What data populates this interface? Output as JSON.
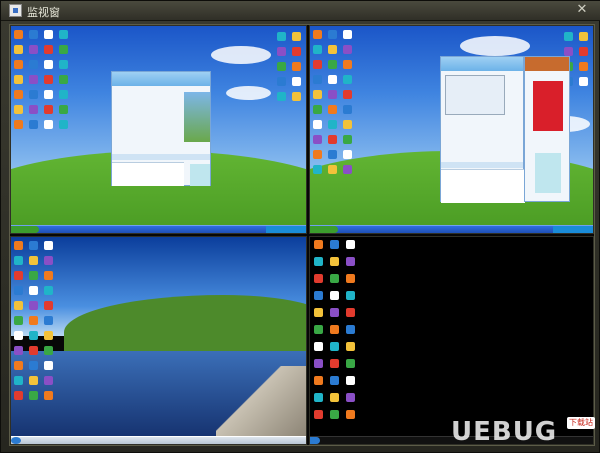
{
  "window": {
    "title": "监视窗",
    "close_glyph": "✕"
  },
  "watermark": {
    "text": "UEBUG",
    "badge": "下载站"
  },
  "colors": {
    "sky": "#3f84e0",
    "grass": "#4fa02a",
    "taskbar": "#2f6ee0",
    "frame": "#3a3a30"
  },
  "panes": [
    {
      "name": "monitor-1",
      "content": "desktop-with-chat-window"
    },
    {
      "name": "monitor-2",
      "content": "desktop-with-chat-window"
    },
    {
      "name": "monitor-3",
      "content": "lake-wallpaper-desktop"
    },
    {
      "name": "monitor-4",
      "content": "black-desktop"
    }
  ]
}
